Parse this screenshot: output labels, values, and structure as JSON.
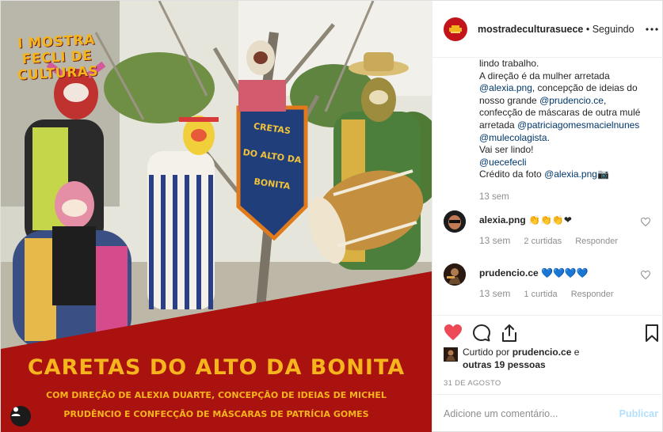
{
  "post_image": {
    "poster_title_lines": [
      "I MOSTRA",
      "FECLI DE",
      "CULTURAS"
    ],
    "banner_text": "CRETAS DO ALTO DA BONITA",
    "main_title": "CARETAS DO ALTO DA BONITA",
    "credit_line_1": "COM DIREÇÃO DE ALEXIA DUARTE, CONCEPÇÃO DE IDEIAS DE MICHEL",
    "credit_line_2": "PRUDÊNCIO E CONFECÇÃO DE MÁSCARAS DE PATRÍCIA GOMES",
    "colors": {
      "red_band": "#a9120f",
      "title_yellow": "#f6b41d"
    }
  },
  "header": {
    "username": "mostradeculturasuece",
    "separator": " • ",
    "follow_status": "Seguindo",
    "more_icon": "ellipsis-icon"
  },
  "caption": {
    "lines": [
      {
        "parts": [
          {
            "t": "lindo trabalho.",
            "m": false
          }
        ]
      },
      {
        "parts": [
          {
            "t": "A direção é da mulher arretada",
            "m": false
          }
        ]
      },
      {
        "parts": [
          {
            "t": "@alexia.png",
            "m": true
          },
          {
            "t": ", concepção de ideias do",
            "m": false
          }
        ]
      },
      {
        "parts": [
          {
            "t": "nosso grande ",
            "m": false
          },
          {
            "t": "@prudencio.ce",
            "m": true
          },
          {
            "t": ",",
            "m": false
          }
        ]
      },
      {
        "parts": [
          {
            "t": "confecção de máscaras de outra mulé",
            "m": false
          }
        ]
      },
      {
        "parts": [
          {
            "t": "arretada ",
            "m": false
          },
          {
            "t": "@patriciagomesmacielnunes",
            "m": true
          }
        ]
      },
      {
        "parts": [
          {
            "t": "@mulecolagista",
            "m": true
          },
          {
            "t": ".",
            "m": false
          }
        ]
      },
      {
        "parts": [
          {
            "t": "Vai ser lindo!",
            "m": false
          }
        ]
      },
      {
        "parts": [
          {
            "t": "@uecefecli",
            "m": true
          }
        ]
      },
      {
        "parts": [
          {
            "t": "Crédito da foto ",
            "m": false
          },
          {
            "t": "@alexia.png",
            "m": true
          },
          {
            "t": "📷",
            "m": false
          }
        ]
      }
    ],
    "time": "13 sem"
  },
  "comments": [
    {
      "username": "alexia.png",
      "text": "👏👏👏❤",
      "time": "13 sem",
      "likes": "2 curtidas",
      "reply": "Responder"
    },
    {
      "username": "prudencio.ce",
      "text": "💙💙💙💙",
      "time": "13 sem",
      "likes": "1 curtida",
      "reply": "Responder"
    }
  ],
  "actions": {
    "liked_by_prefix": "Curtido por ",
    "liked_by_user": "prudencio.ce",
    "liked_by_suffix": " e",
    "liked_by_others": "outras 19 pessoas",
    "date": "31 DE AGOSTO",
    "like_color": "#ed4956"
  },
  "add_comment": {
    "placeholder": "Adicione um comentário...",
    "post_label": "Publicar"
  }
}
